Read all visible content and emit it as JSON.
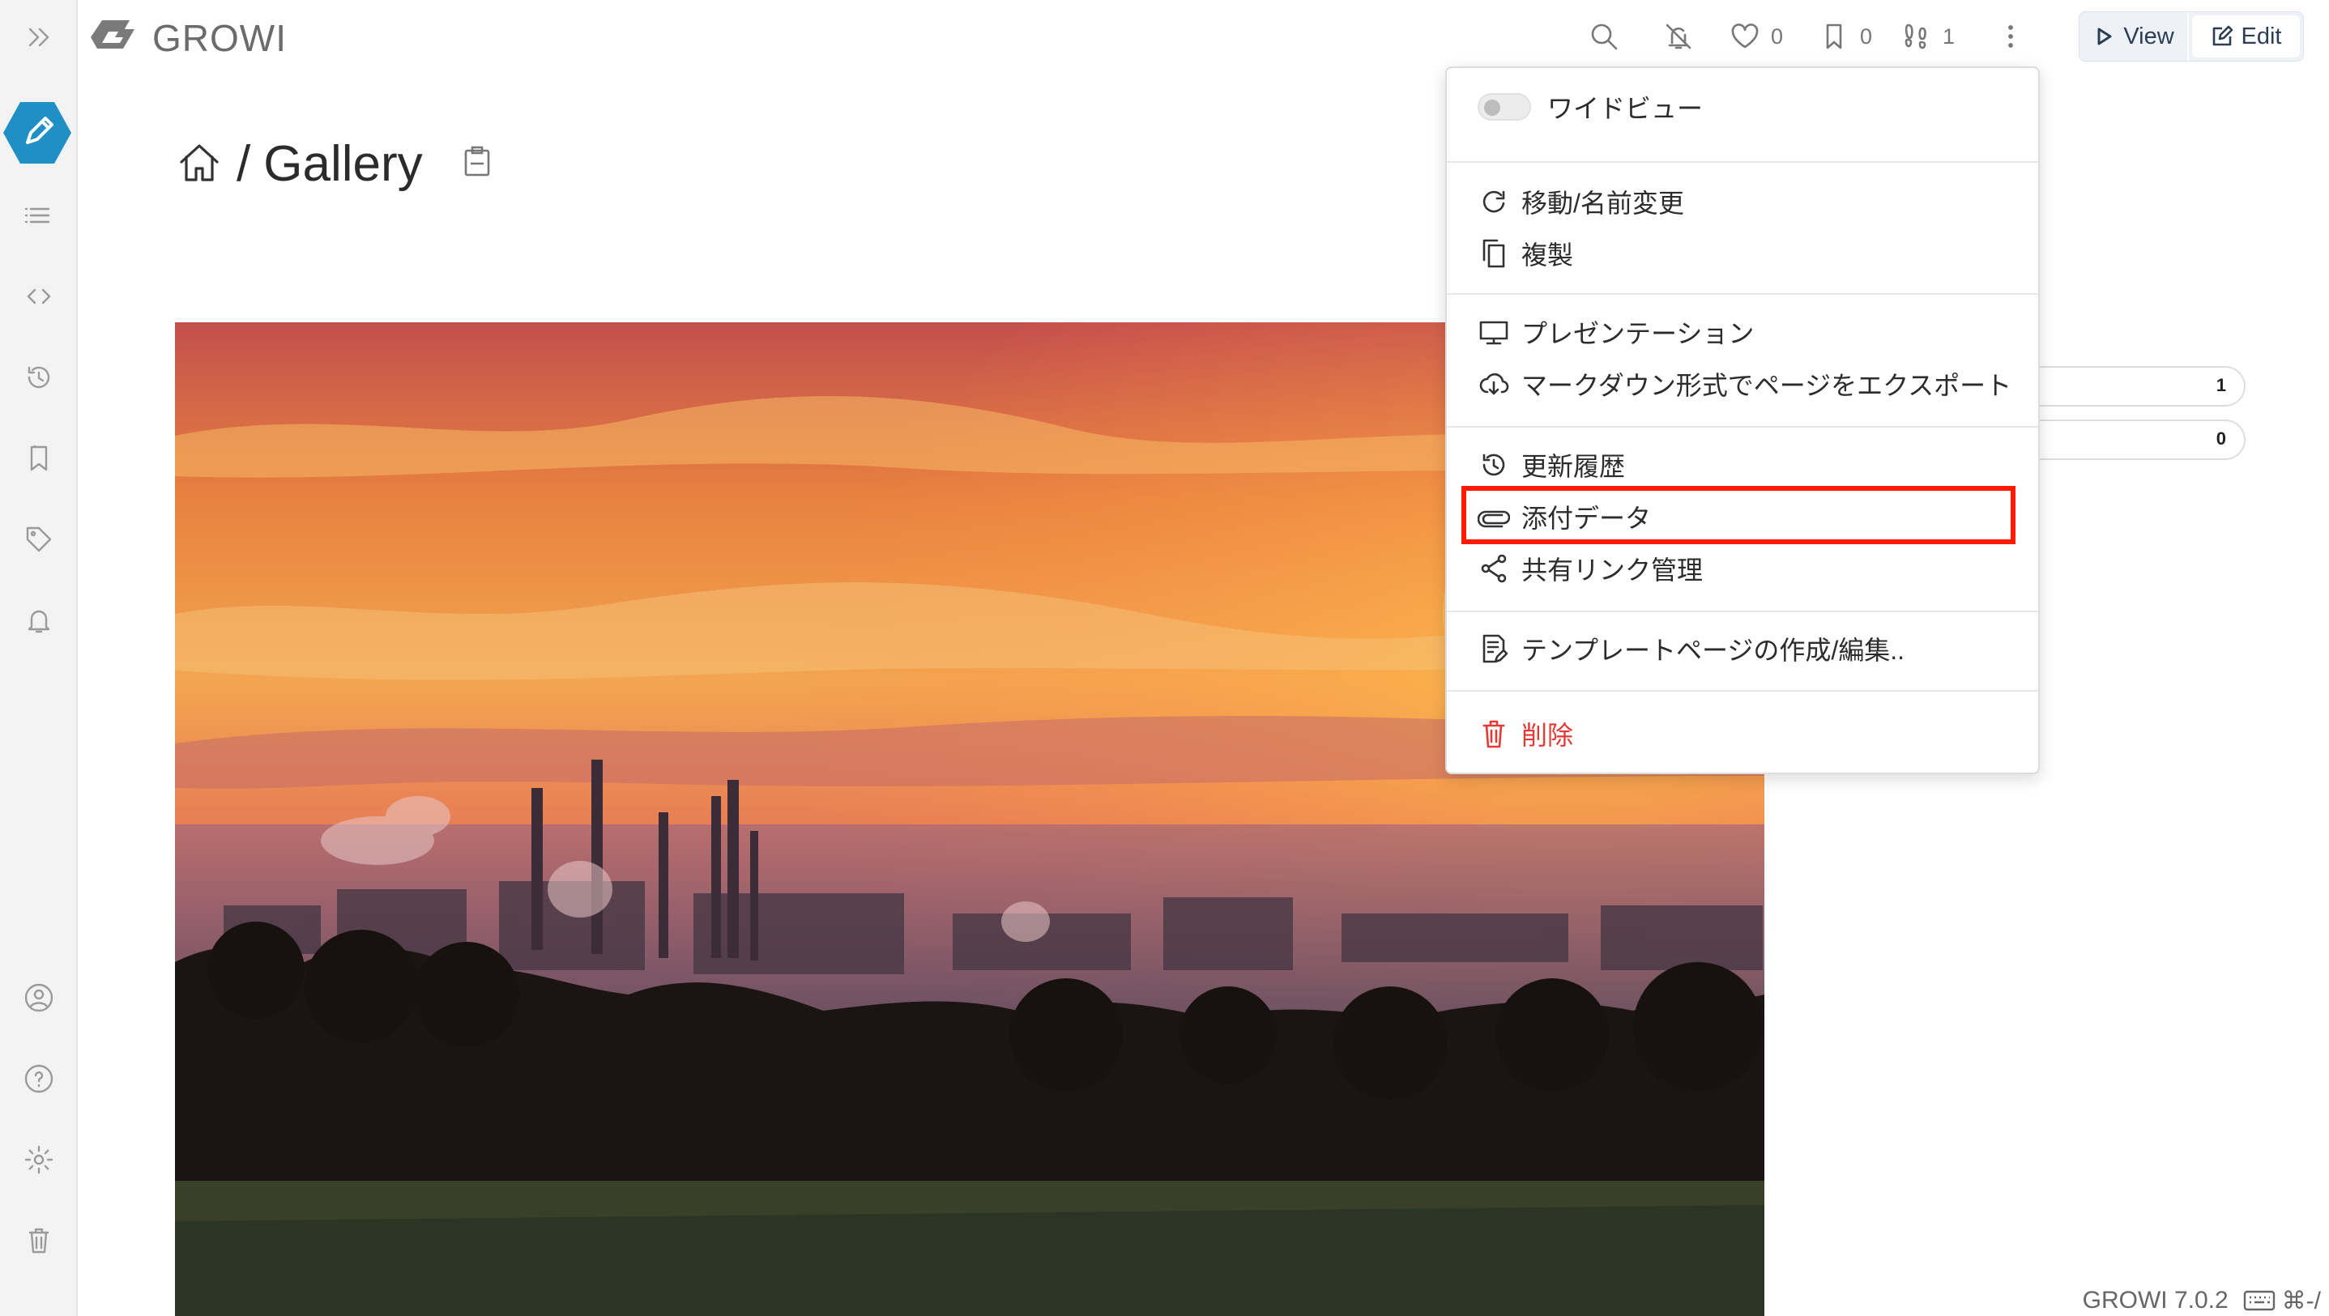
{
  "app": {
    "brand": "GROWI",
    "version": "GROWI 7.0.2",
    "shortcut": "⌘-/"
  },
  "sidebar": {
    "items": [
      {
        "name": "collapse-sidebar",
        "icon": "double-chevron-right-icon"
      },
      {
        "name": "edit",
        "icon": "pencil-icon"
      },
      {
        "name": "page-tree",
        "icon": "list-icon"
      },
      {
        "name": "custom-sidebar",
        "icon": "code-icon"
      },
      {
        "name": "recent-changes",
        "icon": "history-icon"
      },
      {
        "name": "bookmarks",
        "icon": "bookmark-icon"
      },
      {
        "name": "tags",
        "icon": "tag-icon"
      },
      {
        "name": "notifications",
        "icon": "bell-icon"
      },
      {
        "name": "user",
        "icon": "user-circle-icon"
      },
      {
        "name": "help",
        "icon": "help-circle-icon"
      },
      {
        "name": "settings",
        "icon": "gear-icon"
      },
      {
        "name": "trash",
        "icon": "trash-icon"
      }
    ]
  },
  "navbar": {
    "like_count": "0",
    "bookmark_count": "0",
    "seen_count": "1",
    "view_label": "View",
    "edit_label": "Edit"
  },
  "page": {
    "separator": "/",
    "title": "Gallery"
  },
  "side_counts": [
    "1",
    "0"
  ],
  "menu": {
    "wide_view": "ワイドビュー",
    "move_rename": "移動/名前変更",
    "duplicate": "複製",
    "presentation": "プレゼンテーション",
    "export_markdown": "マークダウン形式でページをエクスポート",
    "history": "更新履歴",
    "attachments": "添付データ",
    "share_links": "共有リンク管理",
    "template": "テンプレートページの作成/編集..",
    "delete": "削除"
  },
  "colors": {
    "accent": "#1f8fc4",
    "highlight_border": "#ff1a00",
    "danger": "#e53935"
  }
}
